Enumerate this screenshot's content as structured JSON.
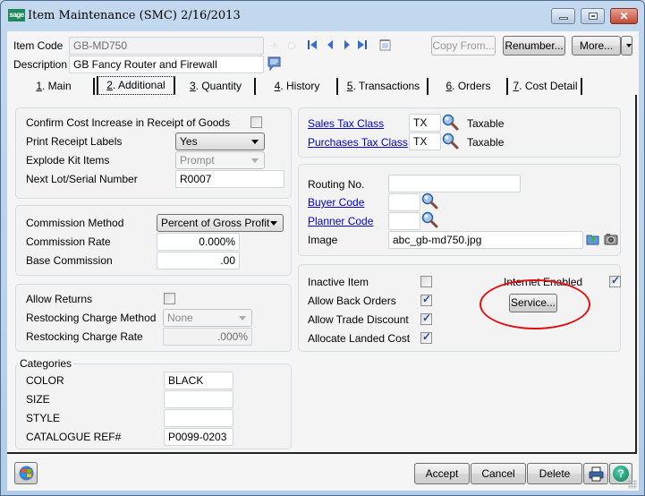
{
  "window": {
    "logo": "sage",
    "title": "Item Maintenance (SMC) 2/16/2013",
    "controls": {
      "minimize": "minimize-icon",
      "maximize": "maximize-icon",
      "close": "close-icon",
      "close_glyph": "✕"
    }
  },
  "header": {
    "item_code_label": "Item Code",
    "item_code_value": "GB-MD750",
    "description_label": "Description",
    "description_value": "GB Fancy Router and Firewall",
    "nav_icons": [
      "new-record-icon",
      "delete-record-icon",
      "first-record-icon",
      "previous-record-icon",
      "next-record-icon",
      "last-record-icon",
      "memo-icon"
    ],
    "comment_icon": "comment-icon",
    "buttons": {
      "copy_from": "Copy From...",
      "renumber": "Renumber...",
      "more": "More..."
    }
  },
  "tabs": [
    {
      "key": "1",
      "label": ". Main",
      "active": false
    },
    {
      "key": "2",
      "label": ". Additional",
      "active": true
    },
    {
      "key": "3",
      "label": ". Quantity",
      "active": false
    },
    {
      "key": "4",
      "label": ". History",
      "active": false
    },
    {
      "key": "5",
      "label": ". Transactions",
      "active": false
    },
    {
      "key": "6",
      "label": ". Orders",
      "active": false
    },
    {
      "key": "7",
      "label": ". Cost Detail",
      "active": false
    }
  ],
  "receipt_group": {
    "confirm_cost_label": "Confirm Cost Increase in Receipt of Goods",
    "confirm_cost_checked": false,
    "print_labels_label": "Print Receipt Labels",
    "print_labels_value": "Yes",
    "explode_kit_label": "Explode Kit Items",
    "explode_kit_value": "Prompt",
    "next_lot_label": "Next Lot/Serial Number",
    "next_lot_value": "R0007"
  },
  "commission_group": {
    "method_label": "Commission Method",
    "method_value": "Percent of Gross Profit",
    "rate_label": "Commission Rate",
    "rate_value": "0.000%",
    "base_label": "Base Commission",
    "base_value": ".00"
  },
  "returns_group": {
    "allow_returns_label": "Allow Returns",
    "allow_returns_checked": false,
    "restock_method_label": "Restocking Charge Method",
    "restock_method_value": "None",
    "restock_rate_label": "Restocking Charge Rate",
    "restock_rate_value": ".000%"
  },
  "categories_group": {
    "title": "Categories",
    "rows": [
      {
        "label": "COLOR",
        "value": "BLACK"
      },
      {
        "label": "SIZE",
        "value": ""
      },
      {
        "label": "STYLE",
        "value": ""
      },
      {
        "label": "CATALOGUE REF#",
        "value": "P0099-0203"
      }
    ]
  },
  "tax_group": {
    "sales_tax_label": "Sales Tax Class",
    "sales_tax_value": "TX",
    "sales_tax_desc": "Taxable",
    "purchases_tax_label": "Purchases Tax Class",
    "purchases_tax_value": "TX",
    "purchases_tax_desc": "Taxable"
  },
  "routing_group": {
    "routing_label": "Routing No.",
    "routing_value": "",
    "buyer_label": "Buyer Code",
    "buyer_value": "",
    "planner_label": "Planner Code",
    "planner_value": "",
    "image_label": "Image",
    "image_value": "abc_gb-md750.jpg"
  },
  "flags_group": {
    "inactive_label": "Inactive Item",
    "inactive_checked": false,
    "back_orders_label": "Allow Back Orders",
    "back_orders_checked": true,
    "trade_discount_label": "Allow Trade Discount",
    "trade_discount_checked": true,
    "landed_cost_label": "Allocate Landed Cost",
    "landed_cost_checked": true,
    "internet_label": "Internet Enabled",
    "internet_checked": true,
    "service_button": "Service..."
  },
  "footer": {
    "accept": "Accept",
    "cancel": "Cancel",
    "delete": "Delete",
    "print_icon": "printer-icon",
    "help_icon": "help-icon",
    "help_glyph": "?"
  },
  "colors": {
    "link": "#0000cc",
    "annotation": "#e01010",
    "sage_green": "#1e8a5a"
  }
}
